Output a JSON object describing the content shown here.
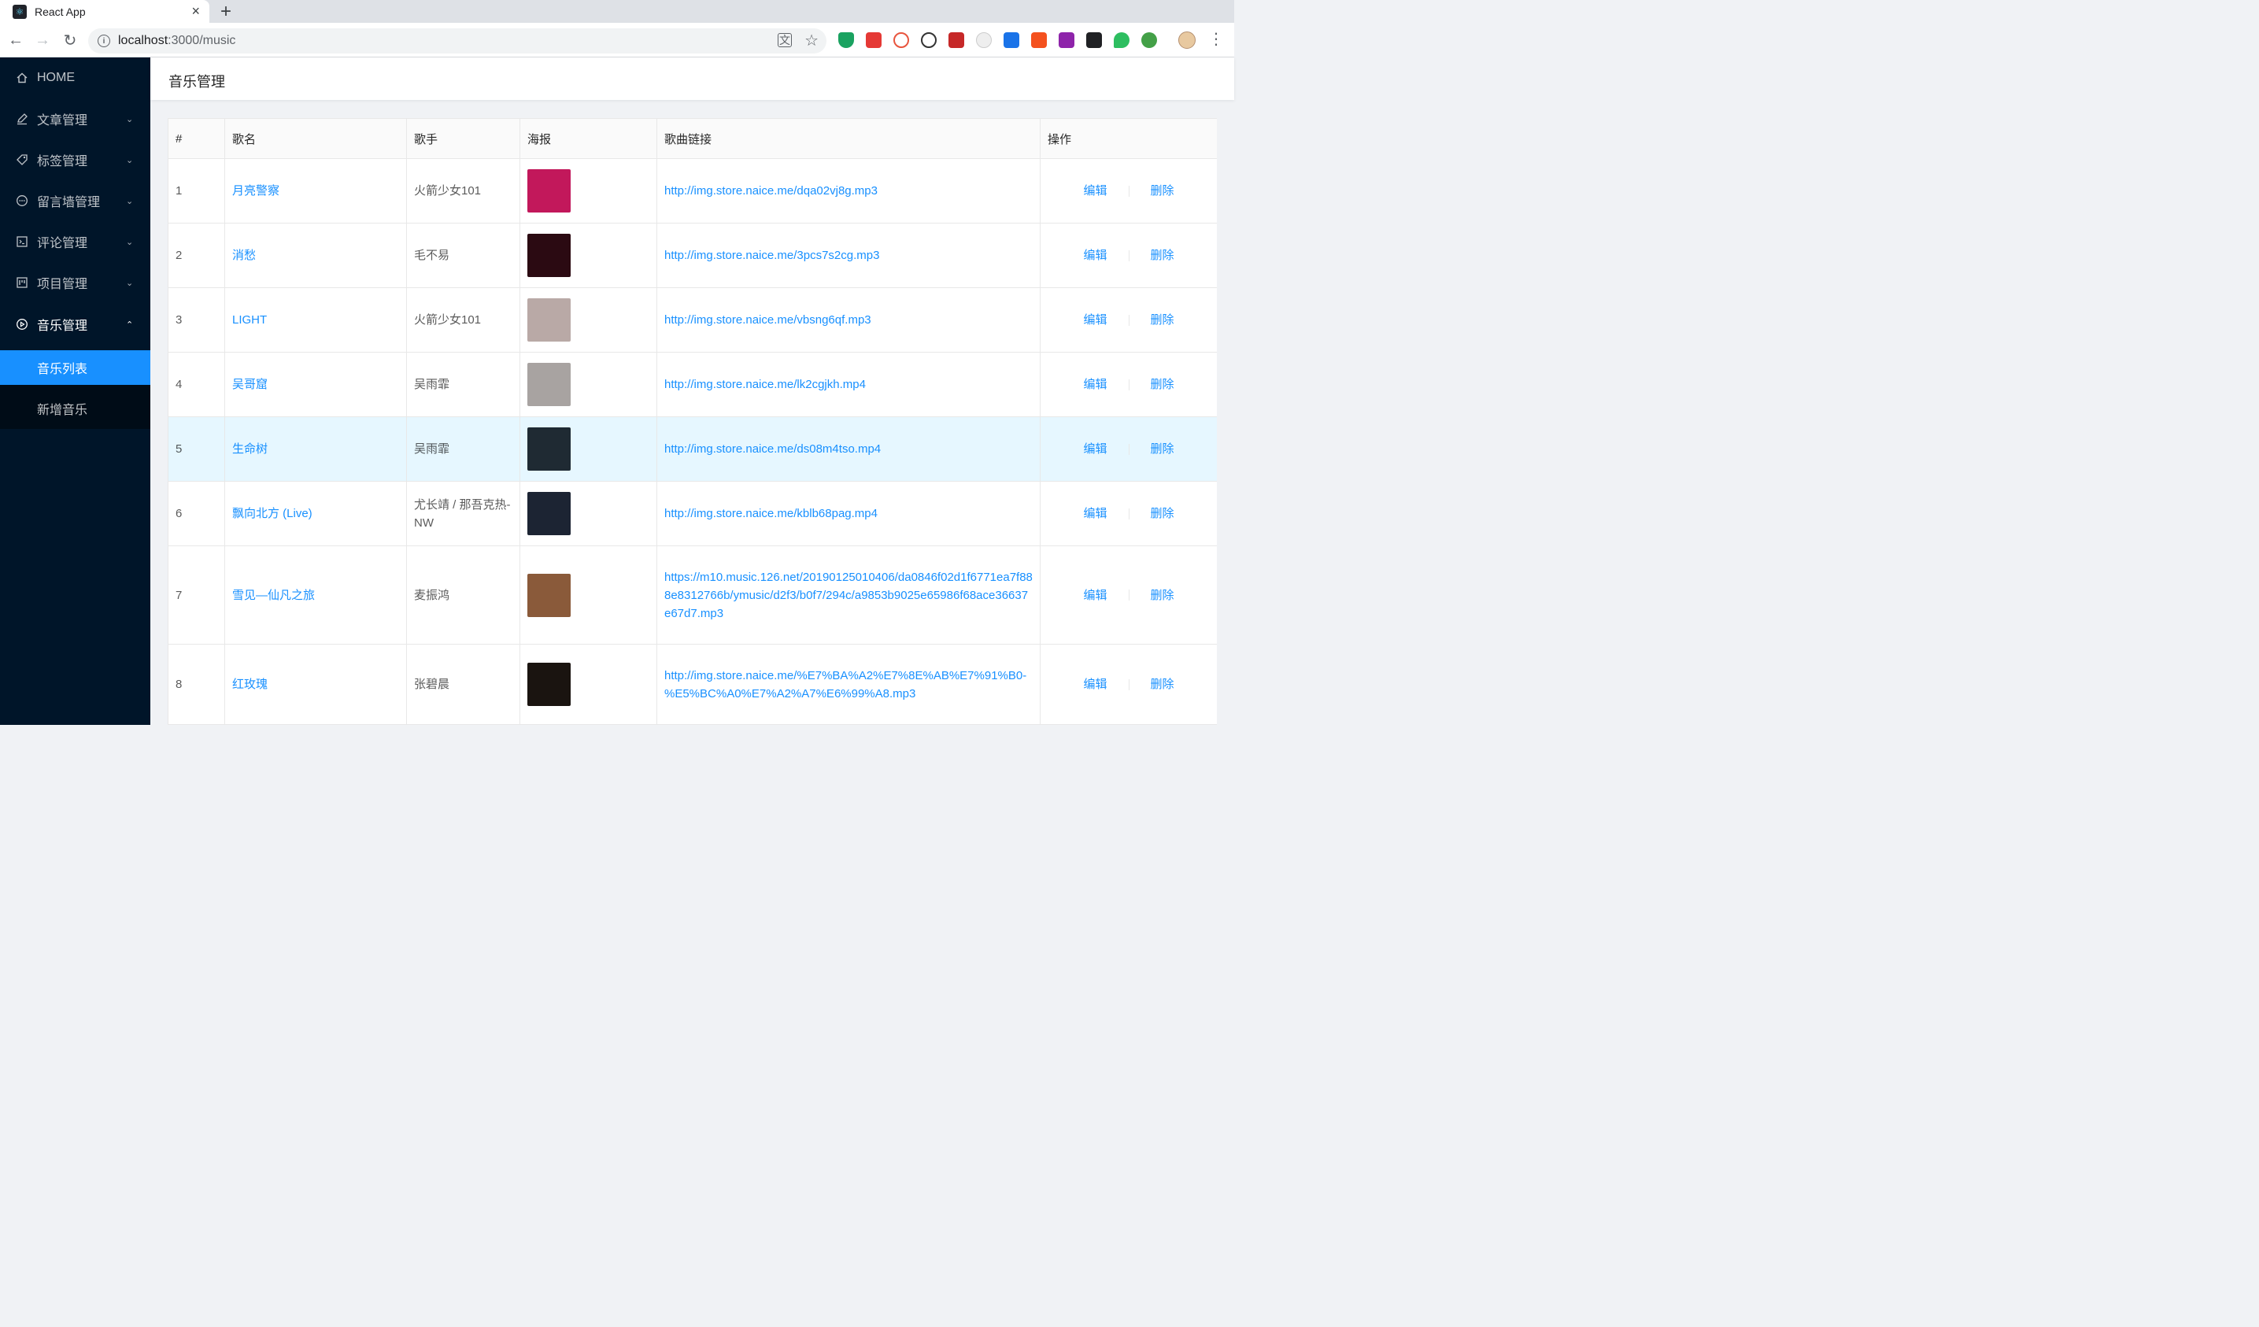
{
  "browser": {
    "tab_title": "React App",
    "url_host": "localhost",
    "url_path": ":3000/music"
  },
  "sidebar": {
    "items": [
      {
        "label": "HOME",
        "icon": "home-icon"
      },
      {
        "label": "文章管理",
        "icon": "edit-icon"
      },
      {
        "label": "标签管理",
        "icon": "tag-icon"
      },
      {
        "label": "留言墙管理",
        "icon": "message-icon"
      },
      {
        "label": "评论管理",
        "icon": "code-icon"
      },
      {
        "label": "项目管理",
        "icon": "project-icon"
      },
      {
        "label": "音乐管理",
        "icon": "play-circle-icon"
      }
    ],
    "sub_items": [
      {
        "label": "音乐列表",
        "selected": true
      },
      {
        "label": "新增音乐",
        "selected": false
      }
    ]
  },
  "header": {
    "title": "音乐管理"
  },
  "table": {
    "columns": [
      "#",
      "歌名",
      "歌手",
      "海报",
      "歌曲链接",
      "操作"
    ],
    "edit_label": "编辑",
    "delete_label": "删除",
    "rows": [
      {
        "no": "1",
        "name": "月亮警察",
        "singer": "火箭少女101",
        "poster_color": "#c2185b",
        "url": "http://img.store.naice.me/dqa02vj8g.mp3"
      },
      {
        "no": "2",
        "name": "消愁",
        "singer": "毛不易",
        "poster_color": "#2b0a12",
        "url": "http://img.store.naice.me/3pcs7s2cg.mp3"
      },
      {
        "no": "3",
        "name": "LIGHT",
        "singer": "火箭少女101",
        "poster_color": "#b9a9a6",
        "url": "http://img.store.naice.me/vbsng6qf.mp3"
      },
      {
        "no": "4",
        "name": "吴哥窟",
        "singer": "吴雨霏",
        "poster_color": "#a8a3a1",
        "url": "http://img.store.naice.me/lk2cgjkh.mp4"
      },
      {
        "no": "5",
        "name": "生命树",
        "singer": "吴雨霏",
        "poster_color": "#1f2a33",
        "url": "http://img.store.naice.me/ds08m4tso.mp4"
      },
      {
        "no": "6",
        "name": "飘向北方 (Live)",
        "singer": "尤长靖 / 那吾克热-NW",
        "poster_color": "#1c2433",
        "url": "http://img.store.naice.me/kblb68pag.mp4"
      },
      {
        "no": "7",
        "name": "雪见—仙凡之旅",
        "singer": "麦振鸿",
        "poster_color": "#8a5a3a",
        "url": "https://m10.music.126.net/20190125010406/da0846f02d1f6771ea7f888e8312766b/ymusic/d2f3/b0f7/294c/a9853b9025e65986f68ace36637e67d7.mp3"
      },
      {
        "no": "8",
        "name": "红玫瑰",
        "singer": "张碧晨",
        "poster_color": "#1a1410",
        "url": "http://img.store.naice.me/%E7%BA%A2%E7%8E%AB%E7%91%B0-%E5%BC%A0%E7%A2%A7%E6%99%A8.mp3"
      }
    ]
  }
}
